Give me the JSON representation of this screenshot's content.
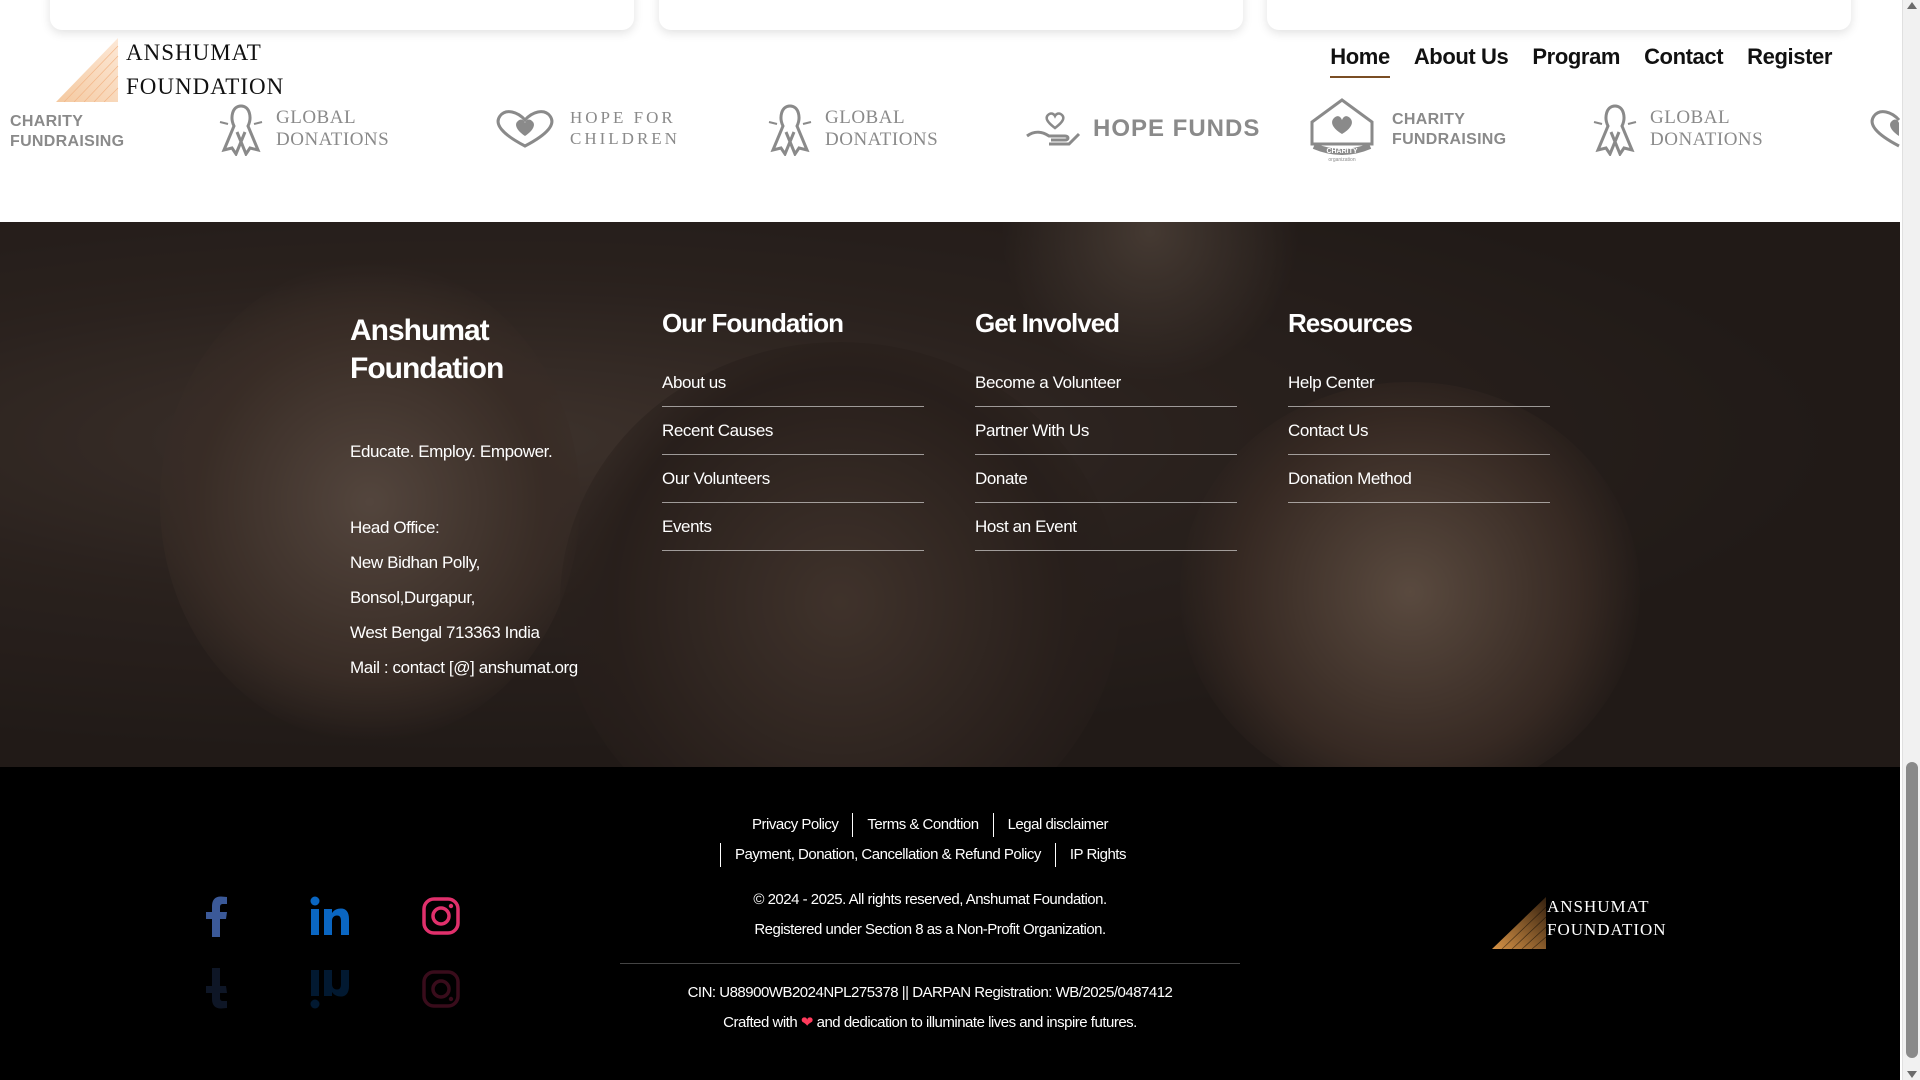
{
  "header": {
    "logo_line1": "ANSHUMAT",
    "logo_line2": "FOUNDATION",
    "nav": [
      {
        "label": "Home",
        "active": true
      },
      {
        "label": "About Us"
      },
      {
        "label": "Program"
      },
      {
        "label": "Contact"
      },
      {
        "label": "Register"
      }
    ]
  },
  "partners": {
    "charity_l1": "CHARITY",
    "charity_l2": "FUNDRAISING",
    "global_l1": "GLOBAL",
    "global_l2": "DONATIONS",
    "hope_children_l1": "HOPE FOR",
    "hope_children_l2": "CHILDREN",
    "hope_funds": "HOPE FUNDS",
    "charity_badge": "CHARITY",
    "charity_badge_sub": "organization"
  },
  "footer": {
    "brand_line1": "Anshumat",
    "brand_line2": "Foundation",
    "tagline": "Educate. Employ. Empower.",
    "address": [
      "Head Office:",
      "New Bidhan Polly,",
      "Bonsol,Durgapur,",
      "West Bengal 713363 India",
      "Mail : contact [@] anshumat.org"
    ],
    "col_foundation": {
      "title": "Our Foundation",
      "links": [
        "About us",
        "Recent Causes",
        "Our Volunteers",
        "Events"
      ]
    },
    "col_involved": {
      "title": "Get Involved",
      "links": [
        "Become a Volunteer",
        "Partner With Us",
        "Donate",
        "Host an Event"
      ]
    },
    "col_resources": {
      "title": "Resources",
      "links": [
        "Help Center",
        "Contact Us",
        "Donation Method"
      ]
    }
  },
  "bottom": {
    "legal_row1": [
      "Privacy Policy",
      "Terms & Condtion",
      "Legal disclaimer"
    ],
    "legal_row2": [
      "Payment, Donation, Cancellation & Refund Policy",
      "IP Rights"
    ],
    "copyright": "© 2024 - 2025. All rights reserved, Anshumat Foundation.",
    "registered": "Registered under Section 8 as a Non-Profit Organization.",
    "cin": "CIN: U88900WB2024NPL275378 || DARPAN Registration: WB/2025/0487412",
    "crafted_pre": "Crafted with",
    "crafted_post": "and dedication to illuminate lives and inspire futures.",
    "logo_line1": "ANSHUMAT",
    "logo_line2": "FOUNDATION"
  },
  "colors": {
    "accent": "#7a4e24",
    "facebook": "#3b5998",
    "linkedin": "#0a66c2",
    "instagram": "#e1306c"
  }
}
